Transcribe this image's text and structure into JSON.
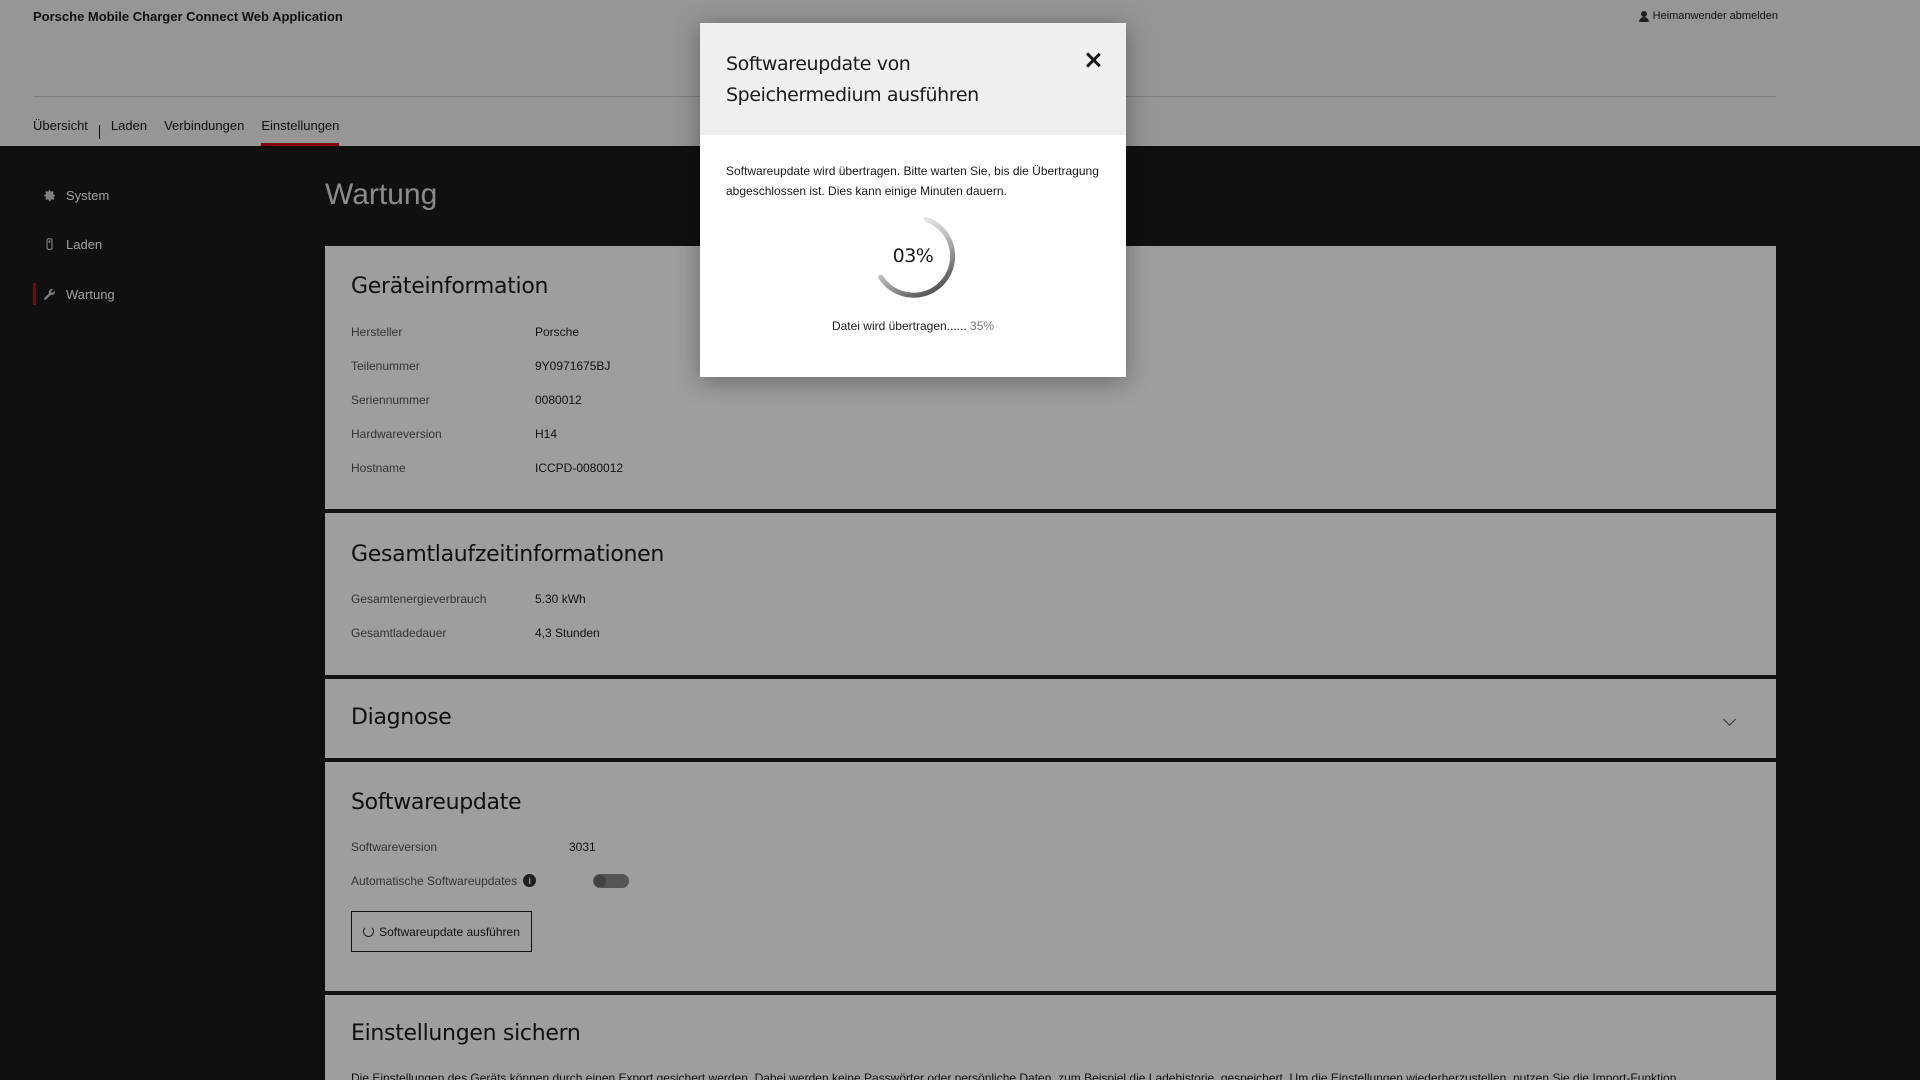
{
  "header": {
    "app_title": "Porsche Mobile Charger Connect Web Application",
    "logout_label": "Heimanwender abmelden",
    "nav": [
      {
        "label": "Übersicht"
      },
      {
        "label": "Laden"
      },
      {
        "label": "Verbindungen"
      },
      {
        "label": "Einstellungen",
        "active": true
      }
    ]
  },
  "sidebar": {
    "items": [
      {
        "label": "System",
        "icon": "gear-icon"
      },
      {
        "label": "Laden",
        "icon": "plug-icon"
      },
      {
        "label": "Wartung",
        "icon": "wrench-icon",
        "active": true
      }
    ]
  },
  "main": {
    "page_title": "Wartung",
    "device_info": {
      "title": "Geräteinformation",
      "rows": [
        {
          "label": "Hersteller",
          "value": "Porsche"
        },
        {
          "label": "Teilenummer",
          "value": "9Y0971675BJ"
        },
        {
          "label": "Seriennummer",
          "value": "0080012"
        },
        {
          "label": "Hardwareversion",
          "value": "H14"
        },
        {
          "label": "Hostname",
          "value": "ICCPD-0080012"
        }
      ]
    },
    "runtime_info": {
      "title": "Gesamtlaufzeitinformationen",
      "rows": [
        {
          "label": "Gesamtenergieverbrauch",
          "value": "5.30 kWh"
        },
        {
          "label": "Gesamtladedauer",
          "value": "4,3 Stunden"
        }
      ]
    },
    "diagnose": {
      "title": "Diagnose"
    },
    "software_update": {
      "title": "Softwareupdate",
      "version_label": "Softwareversion",
      "version_value": "3031",
      "auto_label": "Automatische Softwareupdates",
      "auto_enabled": false,
      "button_label": "Softwareupdate ausführen"
    },
    "backup": {
      "title": "Einstellungen sichern",
      "description": "Die Einstellungen des Geräts können durch einen Export gesichert werden. Dabei werden keine Passwörter oder persönliche Daten, zum Beispiel die Ladehistorie, gespeichert. Um die Einstellungen wiederherzustellen, nutzen Sie die Import-Funktion."
    }
  },
  "modal": {
    "title": "Softwareupdate von Speichermedium ausführen",
    "message": "Softwareupdate wird übertragen. Bitte warten Sie, bis die Übertragung abgeschlossen ist. Dies kann einige Minuten dauern.",
    "spinner_label": "03%",
    "spinner_fraction": 0.03,
    "progress_label": "Datei wird übertragen......",
    "progress_percent": "35%"
  },
  "colors": {
    "accent": "#d5001c",
    "page_bg": "#1a1a1a",
    "card_bg": "#ffffff"
  }
}
